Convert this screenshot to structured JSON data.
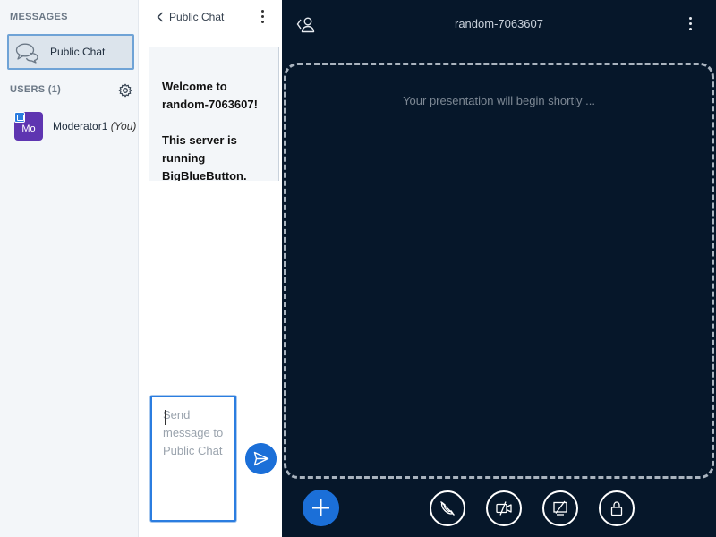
{
  "sidebar": {
    "messages_title": "MESSAGES",
    "public_chat_label": "Public Chat",
    "users_title": "USERS (1)",
    "user": {
      "avatar_initials": "Mo",
      "name": "Moderator1",
      "you_tag": "(You)"
    }
  },
  "chat": {
    "title": "Public Chat",
    "welcome_line1": "Welcome to random-7063607!",
    "welcome_line2": "This server is running BigBlueButton.",
    "input_placeholder": "Send message to Public Chat"
  },
  "main": {
    "room_title": "random-7063607",
    "presentation_placeholder": "Your presentation will begin shortly ..."
  },
  "colors": {
    "accent": "#1B6FD8",
    "background_dark": "#06172A",
    "avatar": "#5E35B1"
  },
  "icons": [
    "speech-bubbles-icon",
    "gear-icon",
    "chevron-left-icon",
    "kebab-menu-icon",
    "user-toggle-icon",
    "send-icon",
    "plus-icon",
    "phone-muted-icon",
    "camera-off-icon",
    "screenshare-off-icon",
    "lock-icon"
  ]
}
